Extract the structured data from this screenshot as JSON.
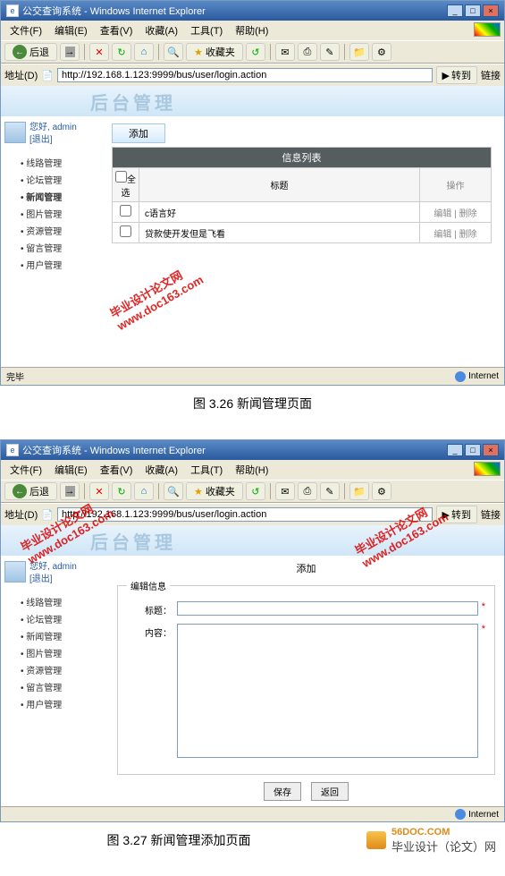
{
  "window": {
    "title": "公交查询系统 - Windows Internet Explorer",
    "min": "_",
    "max": "□",
    "close": "×"
  },
  "menu": {
    "file": "文件(F)",
    "edit": "编辑(E)",
    "view": "查看(V)",
    "favorites": "收藏(A)",
    "tools": "工具(T)",
    "help": "帮助(H)"
  },
  "toolbar": {
    "back": "后退",
    "stop": "✕",
    "refresh": "↻",
    "home": "⌂",
    "search": "🔍",
    "favorites_label": "收藏夹",
    "star": "★"
  },
  "address": {
    "label": "地址(D)",
    "url": "http://192.168.1.123:9999/bus/user/login.action",
    "go": "转到",
    "links": "链接"
  },
  "app": {
    "system_title": "后台管理",
    "welcome_prefix": "您好, ",
    "username": "admin",
    "logout": "[退出]"
  },
  "nav": {
    "items": [
      "线路管理",
      "论坛管理",
      "新闻管理",
      "图片管理",
      "资源管理",
      "留言管理",
      "用户管理"
    ]
  },
  "list_page": {
    "add_button": "添加",
    "table_caption": "信息列表",
    "col_select": "全选",
    "col_title": "标题",
    "col_ops": "操作",
    "rows": [
      {
        "title": "c语言好",
        "ops": "编辑 | 删除"
      },
      {
        "title": "贷款使开发但是飞看",
        "ops": "编辑 | 删除"
      }
    ]
  },
  "form_page": {
    "heading": "添加",
    "legend": "编辑信息",
    "title_label": "标题：",
    "content_label": "内容：",
    "star": "*",
    "save": "保存",
    "back": "返回"
  },
  "status": {
    "done": "完毕",
    "internet": "Internet"
  },
  "captions": {
    "fig1": "图 3.26 新闻管理页面",
    "fig2": "图 3.27 新闻管理添加页面"
  },
  "watermark": {
    "line1": "毕业设计论文网",
    "line2": "www.doc163.com"
  },
  "footer": {
    "text1": "毕业设计（论文）网",
    "text2": "56DOC.COM"
  }
}
